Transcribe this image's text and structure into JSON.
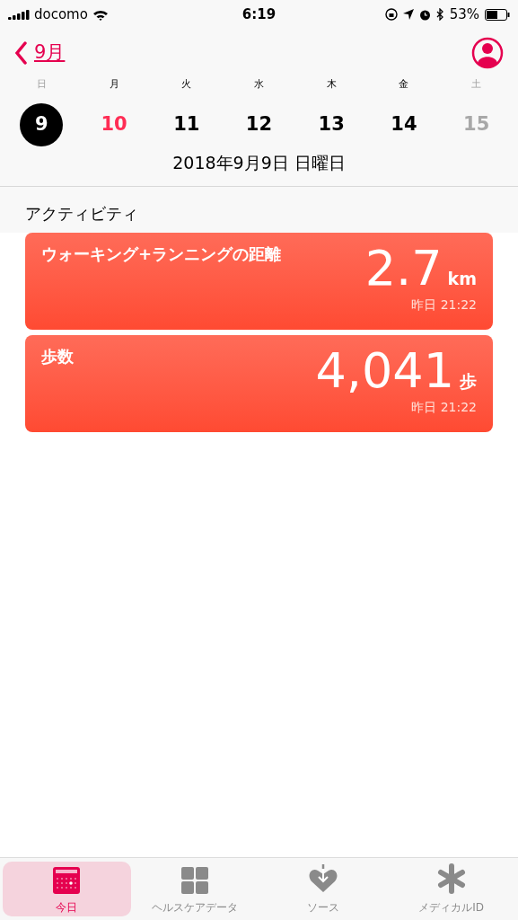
{
  "status_bar": {
    "carrier": "docomo",
    "time": "6:19",
    "battery": "53%"
  },
  "nav": {
    "back_label": "9月"
  },
  "week": [
    {
      "weekday": "日",
      "day": "9",
      "selected": true,
      "today": false,
      "dimmed": true
    },
    {
      "weekday": "月",
      "day": "10",
      "selected": false,
      "today": true,
      "dimmed": false
    },
    {
      "weekday": "火",
      "day": "11",
      "selected": false,
      "today": false,
      "dimmed": false
    },
    {
      "weekday": "水",
      "day": "12",
      "selected": false,
      "today": false,
      "dimmed": false
    },
    {
      "weekday": "木",
      "day": "13",
      "selected": false,
      "today": false,
      "dimmed": false
    },
    {
      "weekday": "金",
      "day": "14",
      "selected": false,
      "today": false,
      "dimmed": false
    },
    {
      "weekday": "土",
      "day": "15",
      "selected": false,
      "today": false,
      "dimmed": true
    }
  ],
  "date_title": "2018年9月9日 日曜日",
  "section_title": "アクティビティ",
  "cards": [
    {
      "title": "ウォーキング+ランニングの距離",
      "value": "2.7",
      "unit": "km",
      "time": "昨日 21:22"
    },
    {
      "title": "歩数",
      "value": "4,041",
      "unit": "歩",
      "time": "昨日 21:22"
    }
  ],
  "tabs": [
    {
      "label": "今日",
      "selected": true
    },
    {
      "label": "ヘルスケアデータ",
      "selected": false
    },
    {
      "label": "ソース",
      "selected": false
    },
    {
      "label": "メディカルID",
      "selected": false
    }
  ]
}
